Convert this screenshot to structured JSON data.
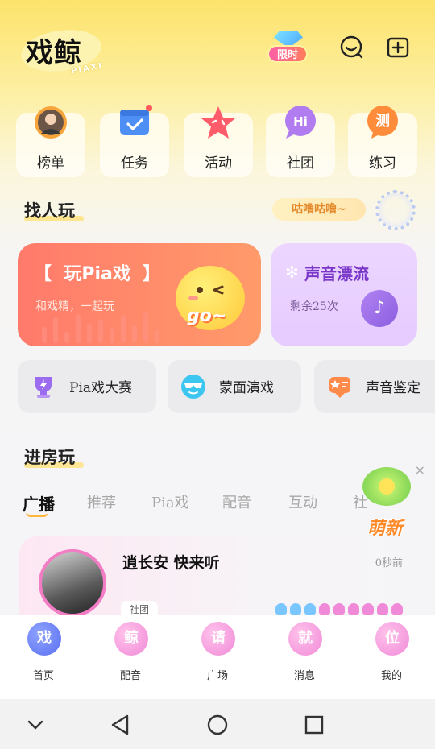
{
  "app": {
    "logo": "戏鲸",
    "logo_sub": "PIAXI"
  },
  "header": {
    "promo_label": "限时",
    "chat_icon": "smile-chat-icon",
    "add_icon": "add-square-icon"
  },
  "categories": [
    {
      "label": "榜单",
      "icon": "avatar-crown-icon"
    },
    {
      "label": "任务",
      "icon": "calendar-check-icon"
    },
    {
      "label": "活动",
      "icon": "star-icon"
    },
    {
      "label": "社团",
      "icon": "hi-bubble-icon"
    },
    {
      "label": "练习",
      "icon": "test-icon",
      "badge": "测"
    }
  ],
  "find_section": {
    "title": "找人玩",
    "bubble": "咕噜咕噜~"
  },
  "card_pia": {
    "title": "【  玩Pia戏  】",
    "subtitle": "和戏精，一起玩",
    "mascot_text": "go~"
  },
  "card_voice": {
    "title": "声音漂流",
    "subtitle": "剩余25次"
  },
  "chips": [
    {
      "label": "Pia戏大赛",
      "icon": "trophy-icon"
    },
    {
      "label": "蒙面演戏",
      "icon": "sunglasses-icon"
    },
    {
      "label": "声音鉴定",
      "icon": "star-card-icon"
    }
  ],
  "room_section": {
    "title": "进房玩"
  },
  "tabs": [
    "广播",
    "推荐",
    "Pia戏",
    "配音",
    "互动",
    "社"
  ],
  "active_tab": "广播",
  "room_card": {
    "title": "逍长安 快来听",
    "time": "0秒前",
    "tag": "社团"
  },
  "float_promo": {
    "text": "萌新",
    "close": "×"
  },
  "bottom_nav": [
    {
      "label": "首页",
      "badge": "戏",
      "color": "#5a6ff0"
    },
    {
      "label": "配音",
      "badge": "鲸",
      "color": "#e56bc2"
    },
    {
      "label": "广场",
      "badge": "请",
      "color": "#e56bc2"
    },
    {
      "label": "消息",
      "badge": "就",
      "color": "#e56bc2"
    },
    {
      "label": "我的",
      "badge": "位",
      "color": "#e56bc2"
    }
  ],
  "colors": {
    "pia_card": "#ff7a6b",
    "voice_card": "#e6cbff",
    "accent": "#ffb43a",
    "voice_text": "#7a35c9"
  }
}
